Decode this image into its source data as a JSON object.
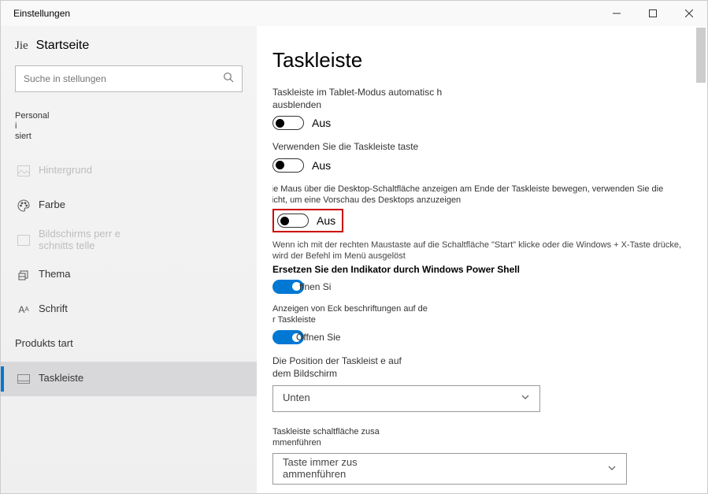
{
  "window": {
    "title": "Einstellungen"
  },
  "sidebar": {
    "home_label": "Startseite",
    "home_prefix": "Jie",
    "search_placeholder": "Suche in stellungen",
    "section_label": "Personal i siert",
    "items": [
      {
        "label": "Hintergrund"
      },
      {
        "label": "Farbe"
      },
      {
        "label": "Bildschirms perr e schnitts telle"
      },
      {
        "label": "Thema"
      },
      {
        "label": "Schrift"
      },
      {
        "label": "Produkts tart"
      },
      {
        "label": "Taskleiste"
      }
    ]
  },
  "main": {
    "title": "Taskleiste",
    "s1_label": "Taskleiste im Tablet-Modus automatisc h ausblenden",
    "s1_toggle": "Aus",
    "s2_label": "Verwenden Sie die Taskleiste taste",
    "s2_toggle": "Aus",
    "peek_desc": "Wenn Sie die Maus über die Desktop-Schaltfläche anzeigen am Ende der Taskleiste bewegen, verwenden Sie die Schnell ansicht, um eine Vorschau des Desktops anzuzeigen",
    "s3_toggle": "Aus",
    "rc_desc": "Wenn ich mit der rechten Maustaste auf die Schaltfläche \"Start\" klicke oder die Windows + X-Taste drücke, wird der Befehl im Menü ausgelöst",
    "rc_bold": "Ersetzen Sie den Indikator durch Windows Power Shell",
    "s4_toggle": "ffnen Si",
    "s5_label": "Anzeigen von Eck beschriftungen auf de r Taskleiste",
    "s5_toggle": "Öffnen Sie",
    "pos_label": "Die Position der Taskleist e auf dem Bildschirm",
    "pos_value": "Unten",
    "combine_label": "Taskleiste schaltfläche zusa mmenführen",
    "combine_value": "Taste immer zus ammenführen"
  }
}
